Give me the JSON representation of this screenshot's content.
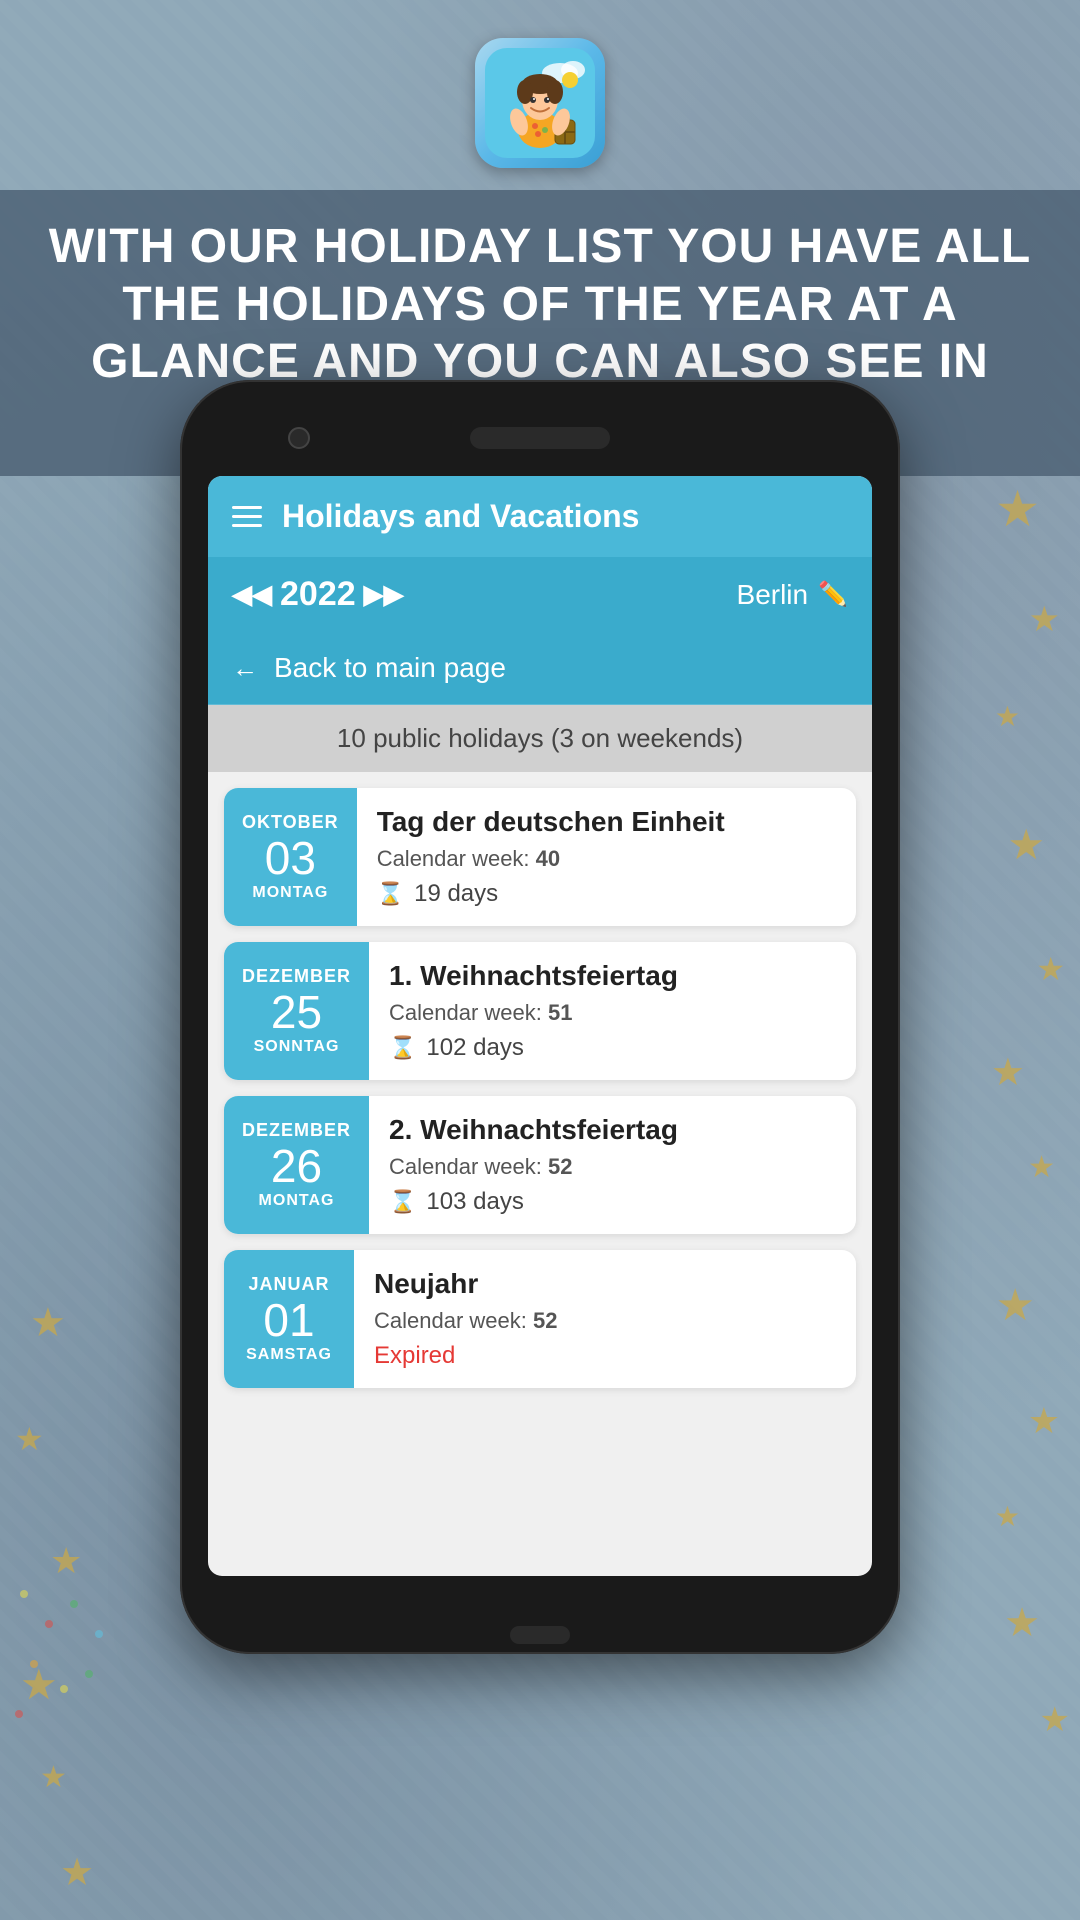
{
  "app": {
    "icon_alt": "holiday-vacation-app-icon",
    "header_banner": "WITH OUR HOLIDAY LIST YOU HAVE ALL THE HOLIDAYS OF THE YEAR AT A GLANCE AND YOU CAN ALSO SEE IN HOW MANY DAYS THEY ARE"
  },
  "phone": {
    "app_title": "Holidays and Vacations",
    "year": "2022",
    "city": "Berlin",
    "back_button_label": "Back to main page",
    "holidays_summary": "10 public holidays (3 on weekends)",
    "holidays": [
      {
        "month": "OKTOBER",
        "day": "03",
        "weekday": "MONTAG",
        "name": "Tag der deutschen Einheit",
        "calendar_week": "40",
        "days_label": "19 days",
        "status": "upcoming"
      },
      {
        "month": "DEZEMBER",
        "day": "25",
        "weekday": "SONNTAG",
        "name": "1. Weihnachtsfeiertag",
        "calendar_week": "51",
        "days_label": "102 days",
        "status": "upcoming"
      },
      {
        "month": "DEZEMBER",
        "day": "26",
        "weekday": "MONTAG",
        "name": "2. Weihnachtsfeiertag",
        "calendar_week": "52",
        "days_label": "103 days",
        "status": "upcoming"
      },
      {
        "month": "JANUAR",
        "day": "01",
        "weekday": "SAMSTAG",
        "name": "Neujahr",
        "calendar_week": "52",
        "days_label": "Expired",
        "status": "expired"
      }
    ],
    "calendar_week_label": "Calendar week: ",
    "hourglass": "⌛"
  },
  "ui": {
    "nav_prev": "◀◀",
    "nav_next": "▶▶",
    "edit_icon": "✏️",
    "back_arrow": "←"
  }
}
